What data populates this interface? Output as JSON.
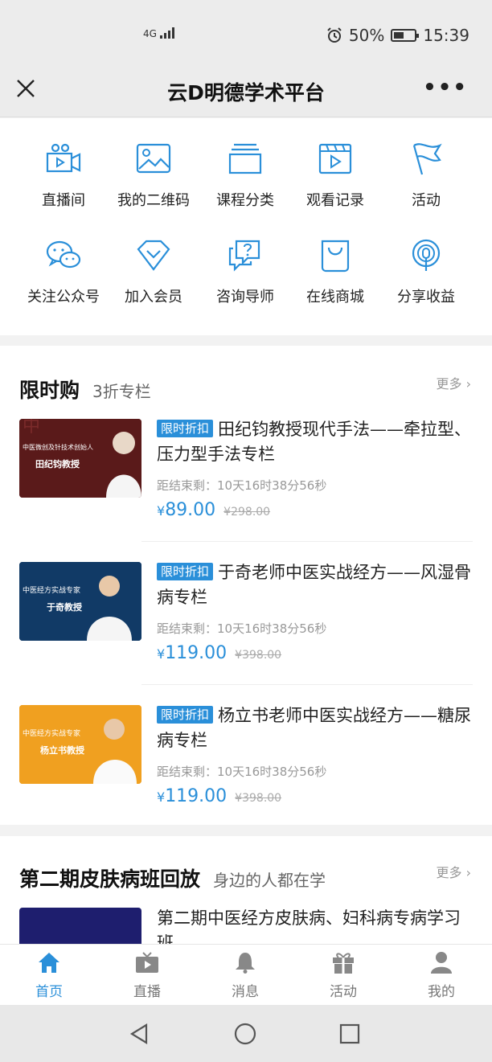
{
  "status": {
    "signal": "4G",
    "battery": "50%",
    "time": "15:39"
  },
  "header": {
    "title": "云D明德学术平台"
  },
  "menu": [
    {
      "label": "直播间",
      "icon": "live-camera-icon"
    },
    {
      "label": "我的二维码",
      "icon": "image-icon"
    },
    {
      "label": "课程分类",
      "icon": "category-icon"
    },
    {
      "label": "观看记录",
      "icon": "video-history-icon"
    },
    {
      "label": "活动",
      "icon": "flag-icon"
    },
    {
      "label": "关注公众号",
      "icon": "wechat-icon"
    },
    {
      "label": "加入会员",
      "icon": "diamond-icon"
    },
    {
      "label": "咨询导师",
      "icon": "question-chat-icon"
    },
    {
      "label": "在线商城",
      "icon": "shopping-bag-icon"
    },
    {
      "label": "分享收益",
      "icon": "broadcast-icon"
    }
  ],
  "flash_sale": {
    "title": "限时购",
    "subtitle": "3折专栏",
    "more": "更多",
    "courses": [
      {
        "badge": "限时折扣",
        "title": "田纪钧教授现代手法——牵拉型、压力型手法专栏",
        "countdown": "距结束剩：10天16时38分56秒",
        "price": "89.00",
        "original": "298.00",
        "thumb_caption": "中医微创及针技术创始人",
        "thumb_name": "田纪钧教授",
        "thumb_color": "#5a1a1a"
      },
      {
        "badge": "限时折扣",
        "title": "于奇老师中医实战经方——风湿骨病专栏",
        "countdown": "距结束剩：10天16时38分56秒",
        "price": "119.00",
        "original": "398.00",
        "thumb_caption": "中医经方实战专家",
        "thumb_name": "于奇教授",
        "thumb_color": "#113a66"
      },
      {
        "badge": "限时折扣",
        "title": "杨立书老师中医实战经方——糖尿病专栏",
        "countdown": "距结束剩：10天16时38分56秒",
        "price": "119.00",
        "original": "398.00",
        "thumb_caption": "中医经方实战专家",
        "thumb_name": "杨立书教授",
        "thumb_color": "#f0a020"
      }
    ]
  },
  "replay": {
    "title": "第二期皮肤病班回放",
    "subtitle": "身边的人都在学",
    "more": "更多",
    "course_title": "第二期中医经方皮肤病、妇科病专病学习班"
  },
  "tabs": [
    {
      "label": "首页",
      "icon": "home-icon",
      "active": true
    },
    {
      "label": "直播",
      "icon": "tv-icon",
      "active": false
    },
    {
      "label": "消息",
      "icon": "bell-icon",
      "active": false
    },
    {
      "label": "活动",
      "icon": "gift-icon",
      "active": false
    },
    {
      "label": "我的",
      "icon": "user-icon",
      "active": false
    }
  ],
  "colors": {
    "accent": "#2a8fd9",
    "background": "#f2f2f2"
  }
}
